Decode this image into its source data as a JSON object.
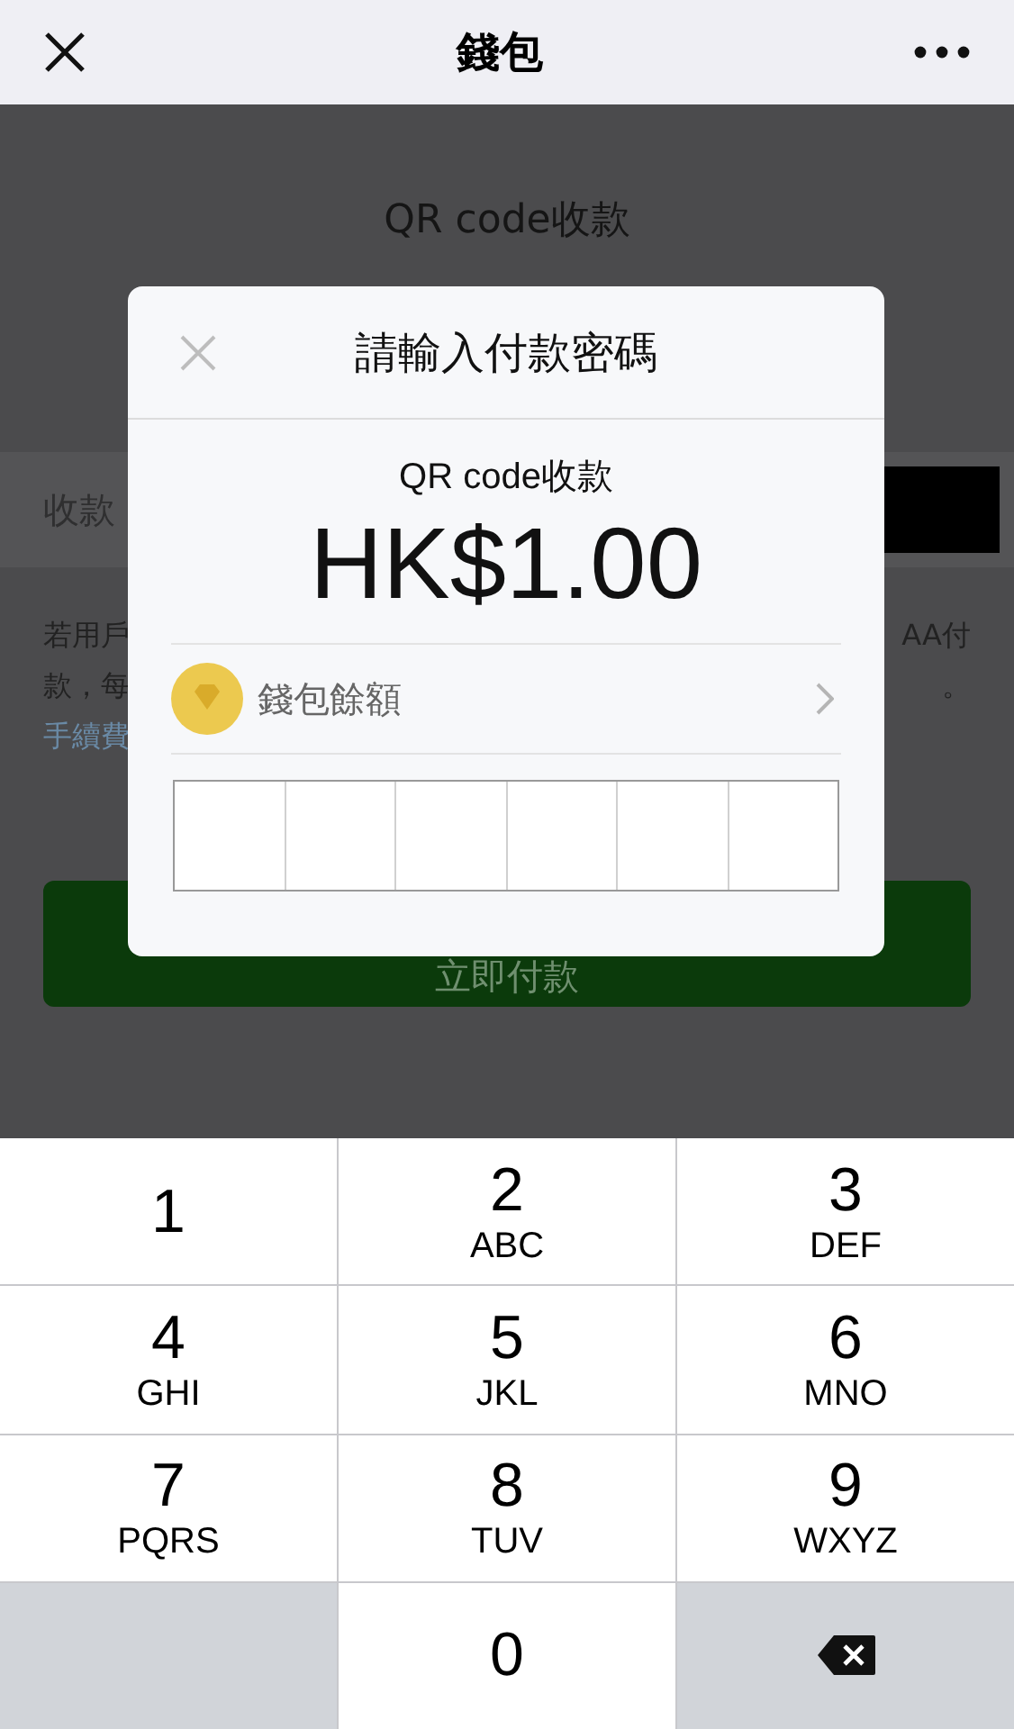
{
  "header": {
    "title": "錢包"
  },
  "page": {
    "title": "QR code收款",
    "field_label": "收款",
    "note_left": [
      "若用戶",
      "款，每",
      "手續費"
    ],
    "note_right": [
      "AA付",
      "。"
    ],
    "pay_button": "立即付款"
  },
  "dialog": {
    "title": "請輸入付款密碼",
    "subtitle": "QR code收款",
    "amount": "HK$1.00",
    "method": "錢包餘額"
  },
  "keypad": [
    {
      "kind": "digit",
      "digit": "1"
    },
    {
      "kind": "digit",
      "digit": "2",
      "letters": "ABC"
    },
    {
      "kind": "digit",
      "digit": "3",
      "letters": "DEF"
    },
    {
      "kind": "digit",
      "digit": "4",
      "letters": "GHI"
    },
    {
      "kind": "digit",
      "digit": "5",
      "letters": "JKL"
    },
    {
      "kind": "digit",
      "digit": "6",
      "letters": "MNO"
    },
    {
      "kind": "digit",
      "digit": "7",
      "letters": "PQRS"
    },
    {
      "kind": "digit",
      "digit": "8",
      "letters": "TUV"
    },
    {
      "kind": "digit",
      "digit": "9",
      "letters": "WXYZ"
    },
    {
      "kind": "blank"
    },
    {
      "kind": "digit",
      "digit": "0"
    },
    {
      "kind": "delete"
    }
  ]
}
